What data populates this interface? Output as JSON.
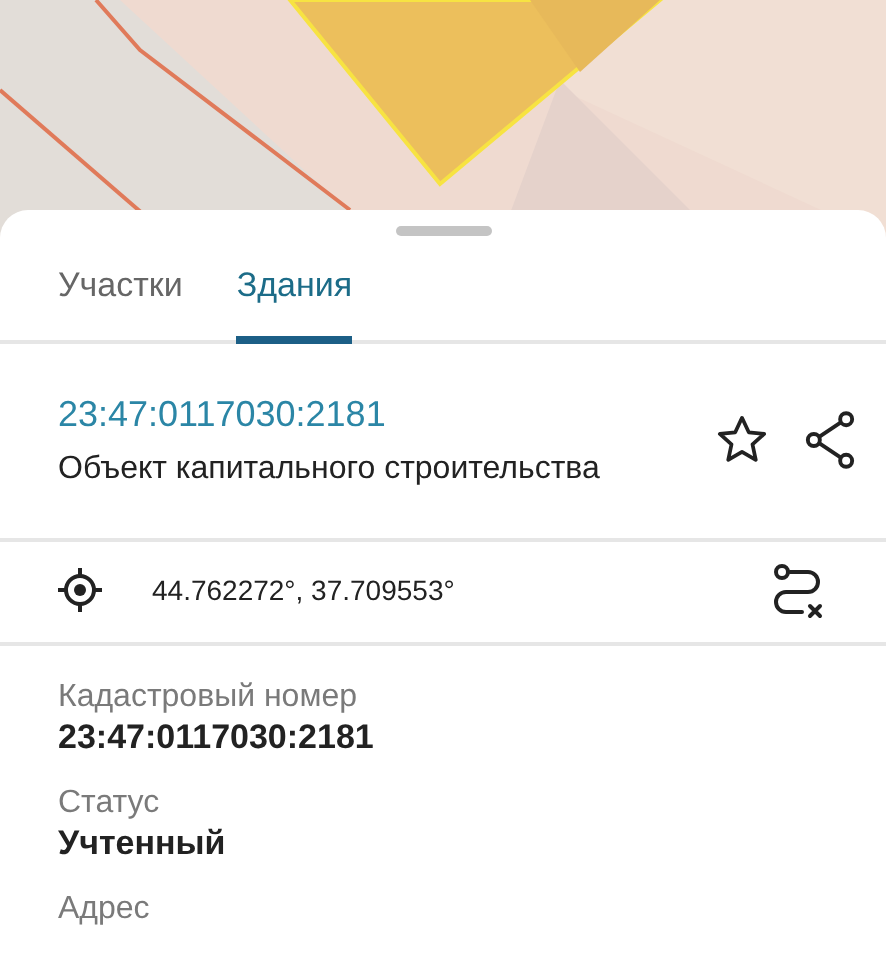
{
  "tabs": [
    {
      "label": "Участки",
      "selected": false
    },
    {
      "label": "Здания",
      "selected": true
    }
  ],
  "object": {
    "cadastral_number": "23:47:0117030:2181",
    "type": "Объект капитального строительства"
  },
  "coordinates": "44.762272°, 37.709553°",
  "fields": [
    {
      "label": "Кадастровый номер",
      "value": "23:47:0117030:2181"
    },
    {
      "label": "Статус",
      "value": "Учтенный"
    },
    {
      "label": "Адрес"
    }
  ]
}
